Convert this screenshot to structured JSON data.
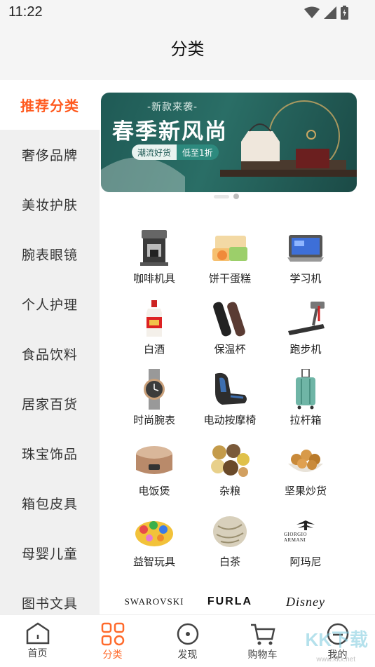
{
  "status_bar": {
    "time": "11:22"
  },
  "header": {
    "title": "分类"
  },
  "sidebar": {
    "items": [
      {
        "label": "推荐分类",
        "active": true
      },
      {
        "label": "奢侈品牌"
      },
      {
        "label": "美妆护肤"
      },
      {
        "label": "腕表眼镜"
      },
      {
        "label": "个人护理"
      },
      {
        "label": "食品饮料"
      },
      {
        "label": "居家百货"
      },
      {
        "label": "珠宝饰品"
      },
      {
        "label": "箱包皮具"
      },
      {
        "label": "母婴儿童"
      },
      {
        "label": "图书文具"
      }
    ]
  },
  "banner": {
    "subtitle": "-新款来袭-",
    "title": "春季新风尚",
    "tag_left": "潮流好货",
    "tag_right": "低至1折"
  },
  "categories": [
    {
      "label": "咖啡机具",
      "icon": "coffee-machine-icon"
    },
    {
      "label": "饼干蛋糕",
      "icon": "biscuit-cake-icon"
    },
    {
      "label": "学习机",
      "icon": "tablet-icon"
    },
    {
      "label": "白酒",
      "icon": "liquor-bottle-icon"
    },
    {
      "label": "保温杯",
      "icon": "thermos-icon"
    },
    {
      "label": "跑步机",
      "icon": "treadmill-icon"
    },
    {
      "label": "时尚腕表",
      "icon": "wristwatch-icon"
    },
    {
      "label": "电动按摩椅",
      "icon": "massage-chair-icon"
    },
    {
      "label": "拉杆箱",
      "icon": "suitcase-icon"
    },
    {
      "label": "电饭煲",
      "icon": "rice-cooker-icon"
    },
    {
      "label": "杂粮",
      "icon": "grains-icon"
    },
    {
      "label": "坚果炒货",
      "icon": "nuts-icon"
    },
    {
      "label": "益智玩具",
      "icon": "toy-icon"
    },
    {
      "label": "白茶",
      "icon": "tea-icon"
    },
    {
      "label": "阿玛尼",
      "icon": "armani-logo"
    }
  ],
  "brands": [
    {
      "logo_text": "SWAROVSKI"
    },
    {
      "logo_text": "FURLA"
    },
    {
      "logo_text": "Disney"
    }
  ],
  "armani_logo": {
    "line1": "GIORGIO ARMANI"
  },
  "tabbar": {
    "tabs": [
      {
        "label": "首页",
        "icon": "home-icon"
      },
      {
        "label": "分类",
        "icon": "category-icon",
        "active": true
      },
      {
        "label": "发现",
        "icon": "discover-icon"
      },
      {
        "label": "购物车",
        "icon": "cart-icon"
      },
      {
        "label": "我的",
        "icon": "profile-icon"
      }
    ]
  },
  "watermark": {
    "text": "KK下载",
    "url": "www.kkx.net"
  },
  "colors": {
    "accent": "#ff5a1f",
    "banner_bg": "#1f5a55"
  }
}
